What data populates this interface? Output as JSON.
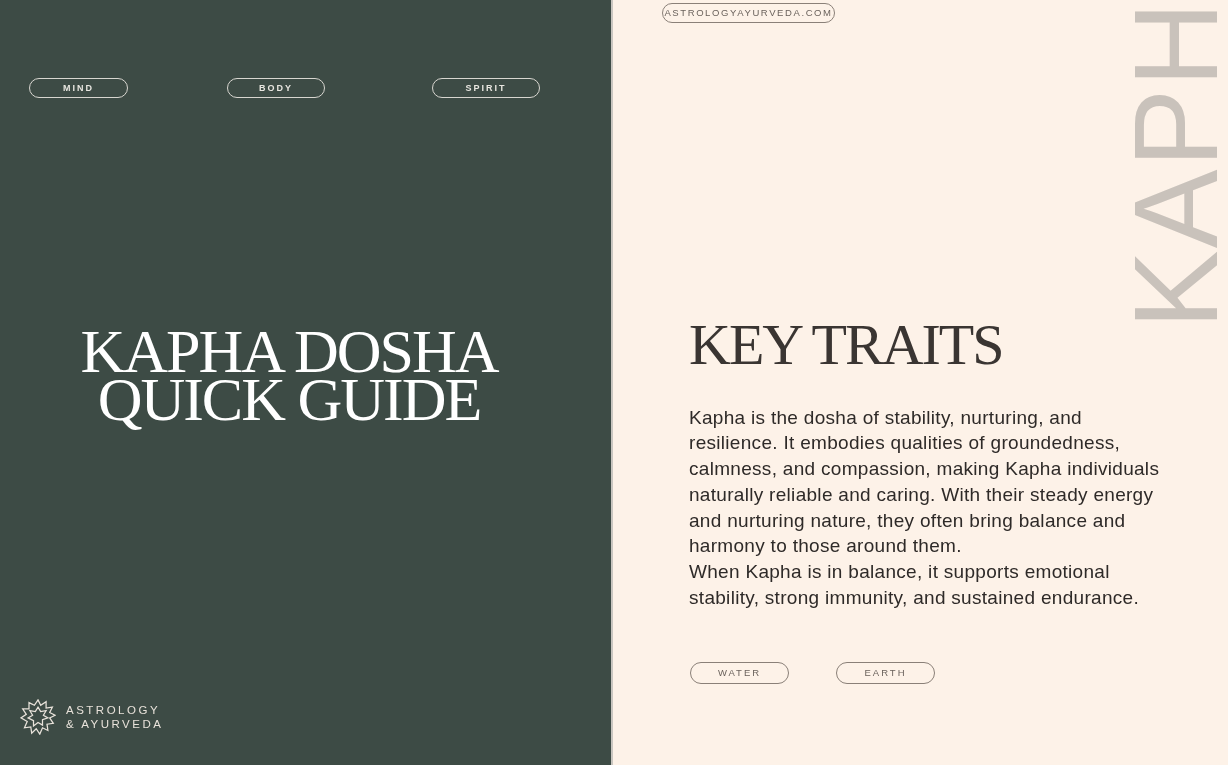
{
  "left_page": {
    "tags": [
      "MIND",
      "BODY",
      "SPIRIT"
    ],
    "title_lines": [
      "KAPHA DOSHA",
      "QUICK GUIDE"
    ],
    "logo": {
      "line_1": "ASTROLOGY",
      "line_2": "& AYURVEDA"
    }
  },
  "right_page": {
    "website": "ASTROLOGYAYURVEDA.COM",
    "side_word": "KAPH",
    "heading": "KEY TRAITS",
    "paragraphs": [
      "Kapha is the dosha of stability, nurturing, and resilience. It embodies qualities of groundedness, calmness, and compassion, making Kapha individuals naturally reliable and caring. With their steady energy and nurturing nature, they often bring balance and harmony to those around them.",
      "When Kapha is in balance, it supports emotional stability, strong immunity, and sustained endurance."
    ],
    "element_tags": [
      "WATER",
      "EARTH"
    ]
  }
}
